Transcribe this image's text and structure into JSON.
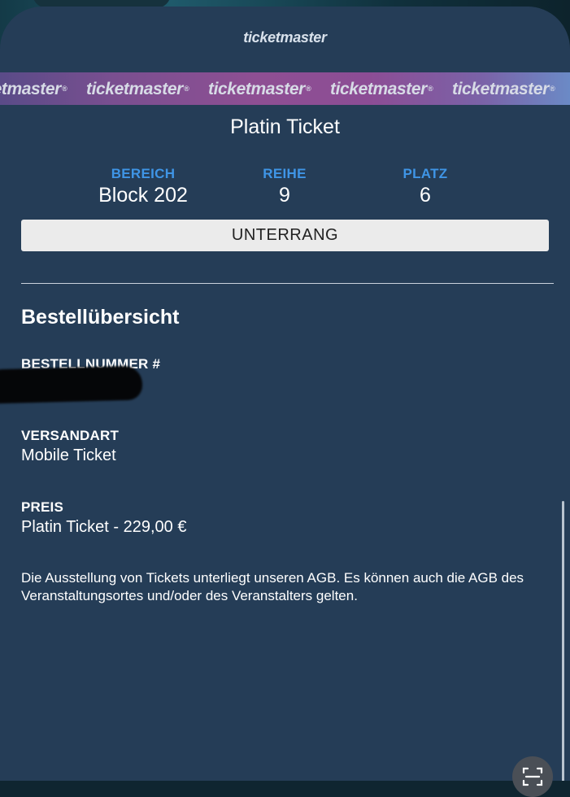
{
  "brand": {
    "logo_text": "ticketmaster"
  },
  "banner": {
    "repeat_text": "ticketmaster",
    "registered_mark": "®"
  },
  "ticket": {
    "type": "Platin Ticket",
    "seat": [
      {
        "label": "BEREICH",
        "value": "Block 202"
      },
      {
        "label": "REIHE",
        "value": "9"
      },
      {
        "label": "PLATZ",
        "value": "6"
      }
    ],
    "section": "UNTERRANG"
  },
  "order": {
    "title": "Bestellübersicht",
    "order_number_label": "BESTELLNUMMER #",
    "delivery_label": "VERSANDART",
    "delivery_value": "Mobile Ticket",
    "price_label": "PREIS",
    "price_value": "Platin Ticket - 229,00 €",
    "legal_text": "Die Ausstellung von Tickets unterliegt unseren AGB. Es können auch die AGB des Veranstaltungsortes und/oder des Veranstalters gelten."
  },
  "icons": {
    "scan": "scan-icon"
  },
  "colors": {
    "card_background": "#253d57",
    "accent_blue": "#3f95e6",
    "banner_purple": "#8e4f93"
  }
}
